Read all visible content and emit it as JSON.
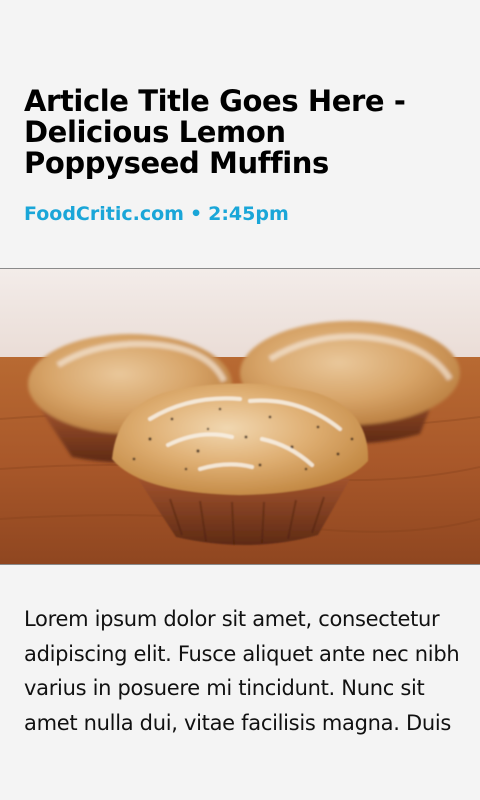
{
  "article": {
    "title": "Article Title Goes Here - Delicious Lemon Poppyseed Muffins",
    "source": "FoodCritic.com",
    "separator": "•",
    "time": "2:45pm",
    "body": "Lorem ipsum dolor sit amet, consectetur adipiscing elit. Fusce aliquet ante nec nibh varius in posuere mi tincidunt. Nunc sit amet nulla dui, vitae facilisis magna. Duis"
  },
  "colors": {
    "background": "#f4f4f4",
    "accent": "#1aa6d8",
    "title": "#000000"
  },
  "image": {
    "subject": "lemon-poppyseed-muffins-photo"
  }
}
